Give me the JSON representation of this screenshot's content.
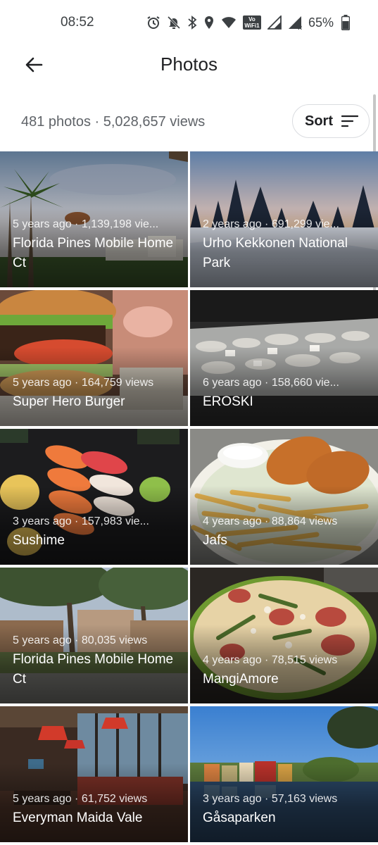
{
  "status_bar": {
    "time": "08:52",
    "wifi_badge": "Vo WiFi1",
    "signal_badge": "R",
    "battery": "65%"
  },
  "app_bar": {
    "back_icon": "arrow-back-icon",
    "title": "Photos"
  },
  "summary": {
    "text": "481 photos · 5,028,657 views",
    "sort_label": "Sort",
    "sort_icon": "sort-lines-icon"
  },
  "photos": [
    {
      "stats": "5 years ago · 1,139,198 vie...",
      "title": "Florida Pines Mobile Home Ct",
      "scene": "palms"
    },
    {
      "stats": "2 years ago · 691,299 vie...",
      "title": "Urho Kekkonen National Park",
      "scene": "snow"
    },
    {
      "stats": "5 years ago · 164,759 views",
      "title": "Super Hero Burger",
      "scene": "burger"
    },
    {
      "stats": "6 years ago · 158,660 vie...",
      "title": "EROSKI",
      "scene": "fish"
    },
    {
      "stats": "3 years ago · 157,983 vie...",
      "title": "Sushime",
      "scene": "sushi"
    },
    {
      "stats": "4 years ago · 88,864 views",
      "title": "Jafs",
      "scene": "fries"
    },
    {
      "stats": "5 years ago · 80,035 views",
      "title": "Florida Pines Mobile Home Ct",
      "scene": "rv"
    },
    {
      "stats": "4 years ago · 78,515 views",
      "title": "MangiAmore",
      "scene": "pizza"
    },
    {
      "stats": "5 years ago · 61,752 views",
      "title": "Everyman Maida Vale",
      "scene": "cinema"
    },
    {
      "stats": "3 years ago · 57,163 views",
      "title": "Gåsaparken",
      "scene": "river"
    }
  ],
  "colors": {
    "text_primary": "#202124",
    "text_secondary": "#5f6368",
    "sort_border": "#dadce0"
  }
}
